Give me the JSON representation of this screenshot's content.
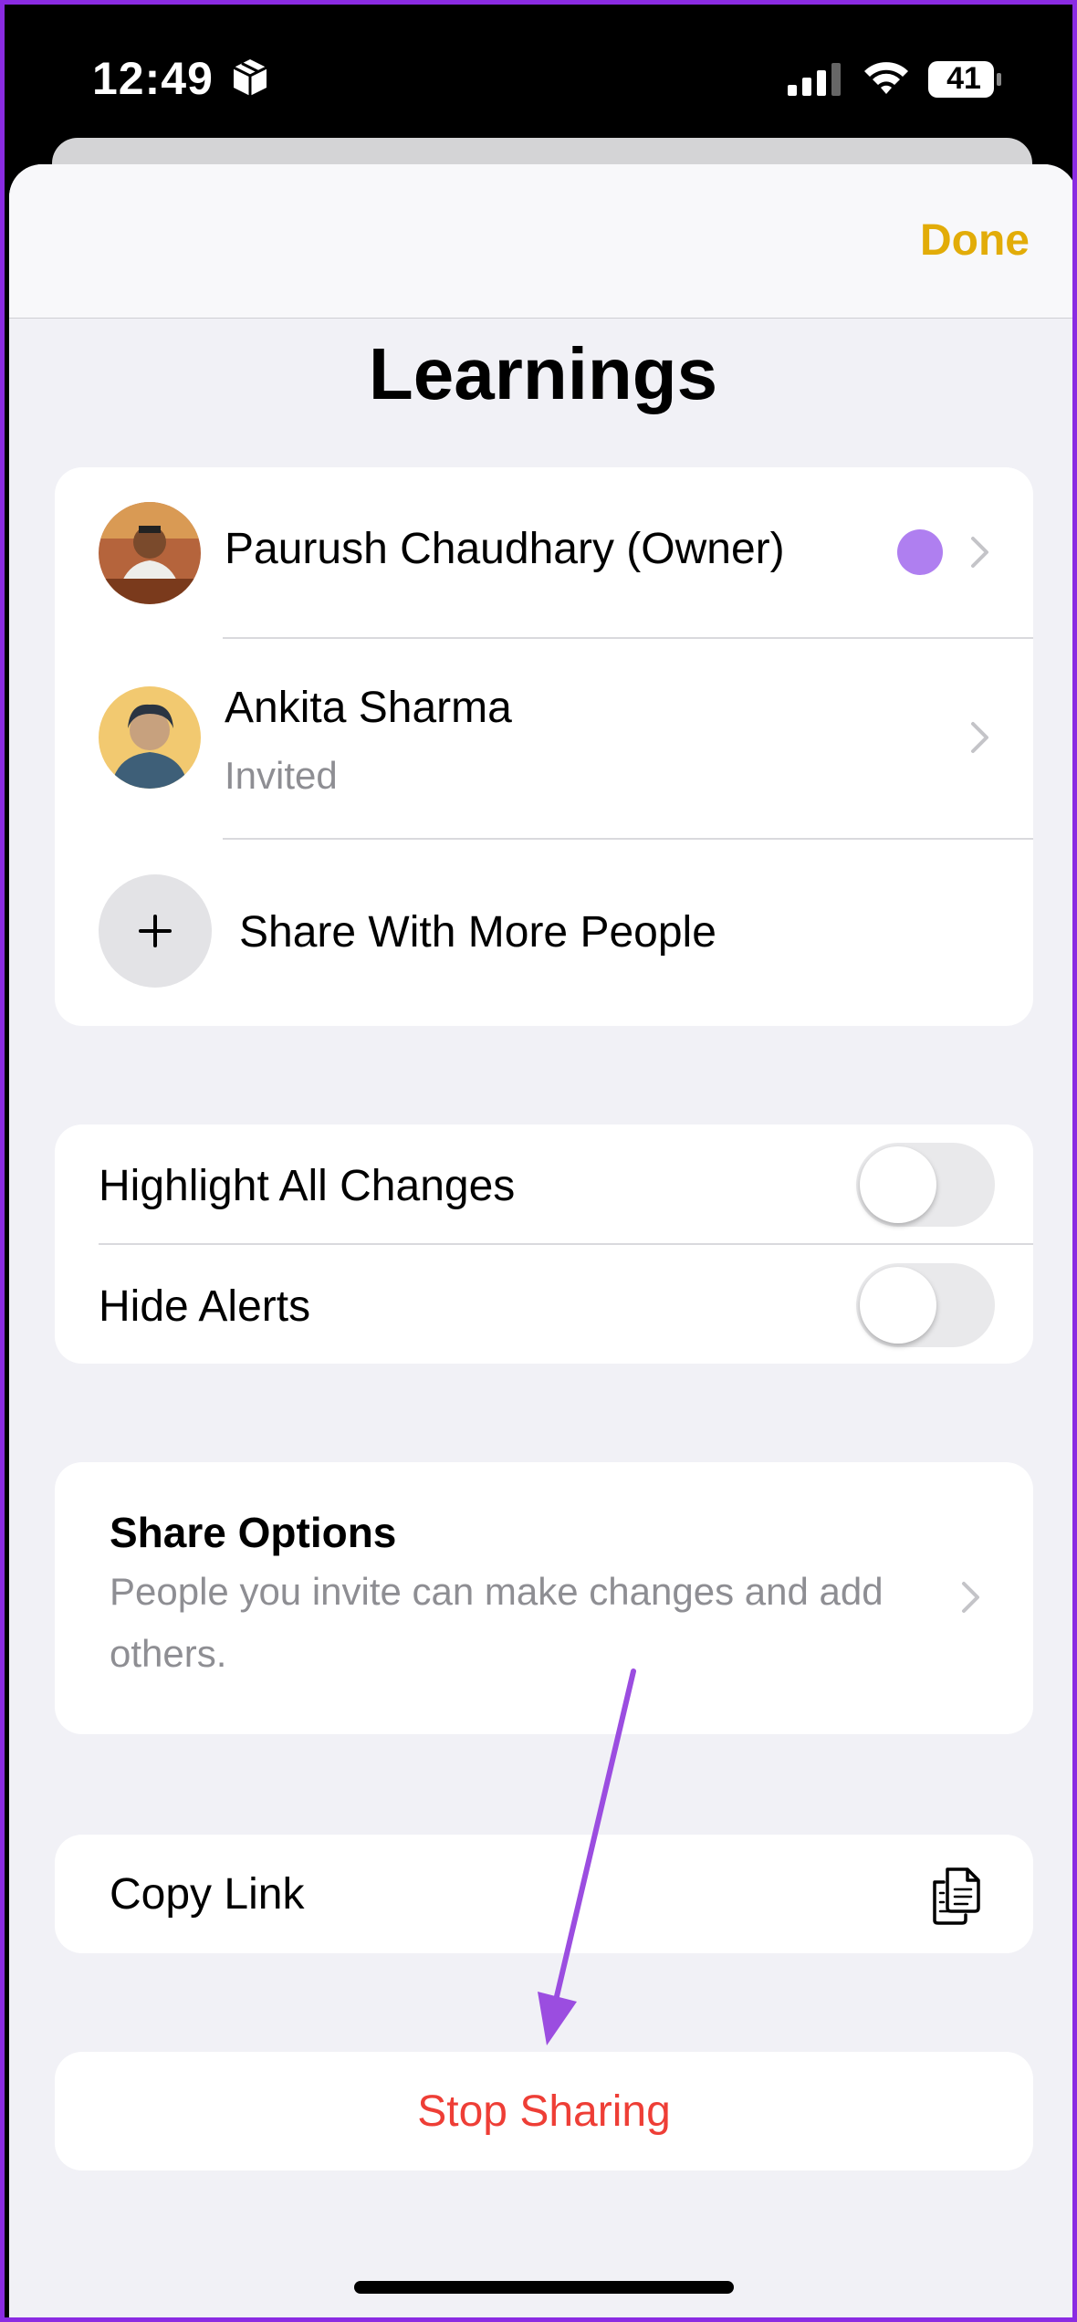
{
  "status_bar": {
    "time": "12:49",
    "battery": "41"
  },
  "nav": {
    "done_label": "Done"
  },
  "title": "Learnings",
  "people": [
    {
      "name": "Paurush Chaudhary (Owner)",
      "subtitle": ""
    },
    {
      "name": "Ankita Sharma",
      "subtitle": "Invited"
    }
  ],
  "share_more_label": "Share With More People",
  "settings": {
    "highlight_label": "Highlight All Changes",
    "highlight_on": false,
    "hide_alerts_label": "Hide Alerts",
    "hide_alerts_on": false
  },
  "share_options": {
    "title": "Share Options",
    "description": "People you invite can make changes and add others."
  },
  "copy_link_label": "Copy Link",
  "stop_sharing_label": "Stop Sharing",
  "colors": {
    "accent_done": "#e2ac08",
    "destructive": "#ee3e36",
    "annotation_arrow": "#9b4de0",
    "owner_dot": "#af7ff0"
  },
  "icons": [
    "cube-icon",
    "signal-icon",
    "wifi-icon",
    "battery-icon",
    "chevron-right-icon",
    "plus-icon",
    "copy-documents-icon"
  ]
}
